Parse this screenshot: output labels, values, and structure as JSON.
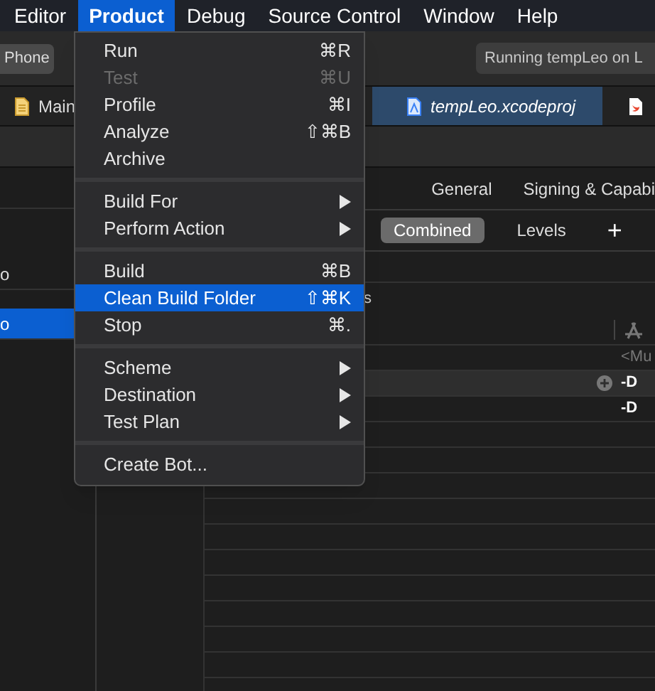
{
  "menu_bar": [
    {
      "label": "Editor",
      "selected": false
    },
    {
      "label": "Product",
      "selected": true
    },
    {
      "label": "Debug",
      "selected": false
    },
    {
      "label": "Source Control",
      "selected": false
    },
    {
      "label": "Window",
      "selected": false
    },
    {
      "label": "Help",
      "selected": false
    }
  ],
  "toolbar": {
    "device_button": "Phone",
    "status": "Running tempLeo on L"
  },
  "editor_tabs": [
    {
      "label": "Main",
      "selected": false,
      "kind": "file"
    },
    {
      "label": "tempLeo.xcodeproj",
      "selected": true,
      "kind": "project"
    },
    {
      "kind": "swift",
      "selected": false
    }
  ],
  "sidebar": {
    "items": [
      {
        "label": "o",
        "selected": false
      },
      {
        "label": "o",
        "selected": true
      }
    ]
  },
  "settings_tabs": [
    {
      "label": "General"
    },
    {
      "label": "Signing & Capabi"
    }
  ],
  "segmented": [
    {
      "label": "Combined",
      "selected": true
    },
    {
      "label": "Levels",
      "selected": false
    }
  ],
  "add_button": "+",
  "section_label": "s",
  "table": {
    "rows": [
      {
        "text": "<Mu",
        "kind": "muted",
        "selected": false
      },
      {
        "text": "-D",
        "kind": "value",
        "selected": true
      },
      {
        "text": "-D",
        "kind": "value",
        "selected": false
      }
    ]
  },
  "dropdown_menu": {
    "sections": [
      {
        "items": [
          {
            "label": "Run",
            "shortcut": "⌘R",
            "disabled": false,
            "submenu": false,
            "selected": false
          },
          {
            "label": "Test",
            "shortcut": "⌘U",
            "disabled": true,
            "submenu": false,
            "selected": false
          },
          {
            "label": "Profile",
            "shortcut": "⌘I",
            "disabled": false,
            "submenu": false,
            "selected": false
          },
          {
            "label": "Analyze",
            "shortcut": "⇧⌘B",
            "disabled": false,
            "submenu": false,
            "selected": false
          },
          {
            "label": "Archive",
            "disabled": false,
            "submenu": false,
            "selected": false
          }
        ]
      },
      {
        "items": [
          {
            "label": "Build For",
            "disabled": false,
            "submenu": true,
            "selected": false
          },
          {
            "label": "Perform Action",
            "disabled": false,
            "submenu": true,
            "selected": false
          }
        ]
      },
      {
        "items": [
          {
            "label": "Build",
            "shortcut": "⌘B",
            "disabled": false,
            "submenu": false,
            "selected": false
          },
          {
            "label": "Clean Build Folder",
            "shortcut": "⇧⌘K",
            "disabled": false,
            "submenu": false,
            "selected": true
          },
          {
            "label": "Stop",
            "shortcut": "⌘.",
            "disabled": false,
            "submenu": false,
            "selected": false
          }
        ]
      },
      {
        "items": [
          {
            "label": "Scheme",
            "disabled": false,
            "submenu": true,
            "selected": false
          },
          {
            "label": "Destination",
            "disabled": false,
            "submenu": true,
            "selected": false
          },
          {
            "label": "Test Plan",
            "disabled": false,
            "submenu": true,
            "selected": false
          }
        ]
      },
      {
        "items": [
          {
            "label": "Create Bot...",
            "disabled": false,
            "submenu": false,
            "selected": false
          }
        ]
      }
    ]
  }
}
